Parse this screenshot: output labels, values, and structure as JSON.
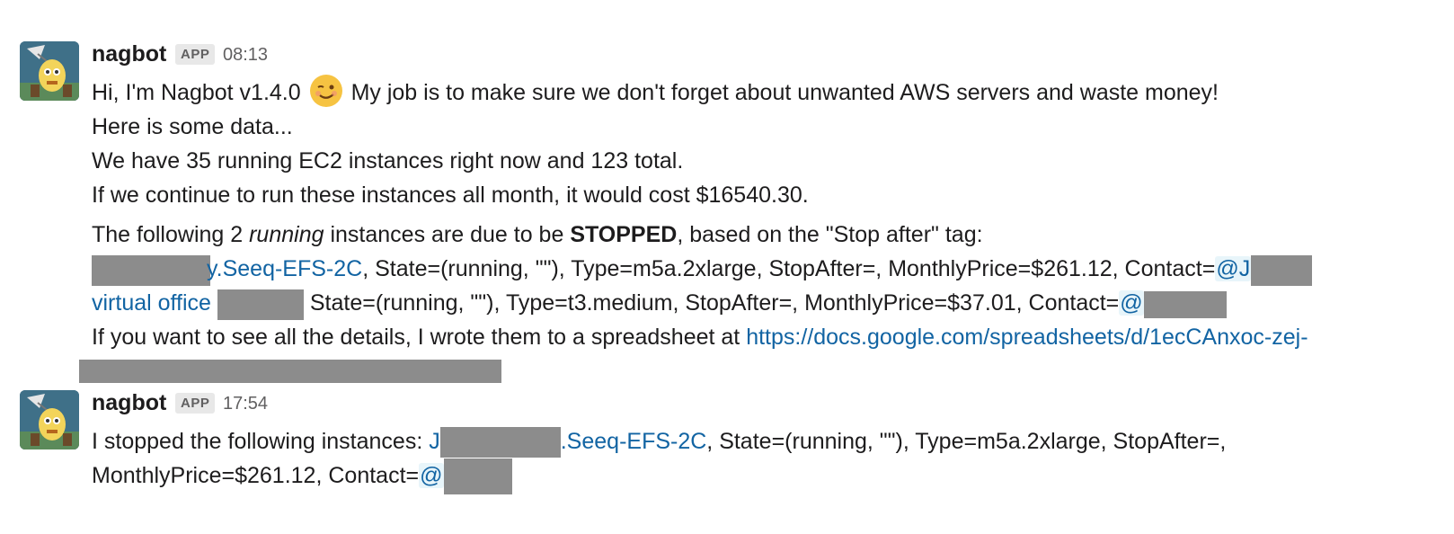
{
  "messages": [
    {
      "sender": "nagbot",
      "badge": "APP",
      "time": "08:13",
      "line1_a": "Hi, I'm Nagbot v1.4.0",
      "emoji": "winking-face",
      "line1_b": "My job is to make sure we don't forget about unwanted AWS servers and waste money!",
      "line2": "Here is some data...",
      "line3": "We have 35 running EC2 instances right now and 123 total.",
      "line4": "If we continue to run these instances all month, it would cost $16540.30.",
      "stopped_intro_a": "The following 2 ",
      "stopped_intro_em": "running",
      "stopped_intro_b": " instances are due to be ",
      "stopped_intro_strong": "STOPPED",
      "stopped_intro_c": ", based on the \"Stop after\" tag:",
      "instance1_link": "y.Seeq-EFS-2C",
      "instance1_details": ", State=(running, \"\"), Type=m5a.2xlarge, StopAfter=, MonthlyPrice=$261.12, Contact=",
      "instance1_mention": "@J",
      "instance2_link": "virtual office",
      "instance2_details": "State=(running, \"\"), Type=t3.medium, StopAfter=, MonthlyPrice=$37.01, Contact=",
      "instance2_mention": "@",
      "details_text": "If you want to see all the details, I wrote them to a spreadsheet at ",
      "details_link": "https://docs.google.com/spreadsheets/d/1ecCAnxoc-zej-"
    },
    {
      "sender": "nagbot",
      "badge": "APP",
      "time": "17:54",
      "text": "I stopped the following instances: ",
      "instance_link_a": "J",
      "instance_link_b": ".Seeq-EFS-2C",
      "instance_details": ", State=(running, \"\"), Type=m5a.2xlarge, StopAfter=,",
      "line2_text": "MonthlyPrice=$261.12, Contact=",
      "mention": "@"
    }
  ]
}
